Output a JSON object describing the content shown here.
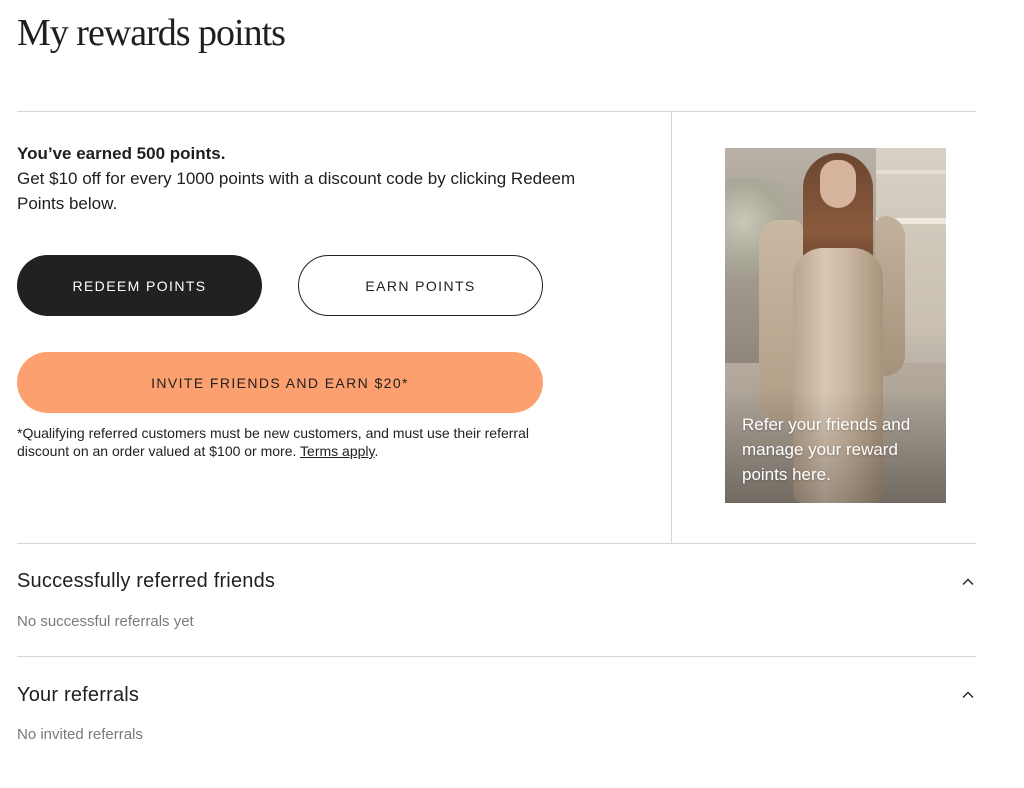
{
  "page": {
    "title": "My rewards points"
  },
  "points": {
    "earned_text": "You’ve earned 500 points.",
    "info_text": "Get $10 off for every 1000 points with a discount code by clicking Redeem Points below."
  },
  "buttons": {
    "redeem_label": "REDEEM POINTS",
    "earn_label": "EARN POINTS",
    "invite_label": "INVITE FRIENDS AND EARN $20*"
  },
  "disclaimer": {
    "text": "*Qualifying referred customers must be new customers, and must use their referral discount on an order valued at $100 or more. ",
    "terms_link": "Terms apply",
    "suffix": "."
  },
  "promo": {
    "caption": "Refer your friends and manage your reward points here."
  },
  "sections": [
    {
      "title": "Successfully referred friends",
      "empty_text": "No successful referrals yet"
    },
    {
      "title": "Your referrals",
      "empty_text": "No invited referrals"
    }
  ],
  "colors": {
    "accent": "#fda06f",
    "dark": "#222120"
  },
  "icons": {
    "section_toggle": "chevron-up-icon"
  }
}
